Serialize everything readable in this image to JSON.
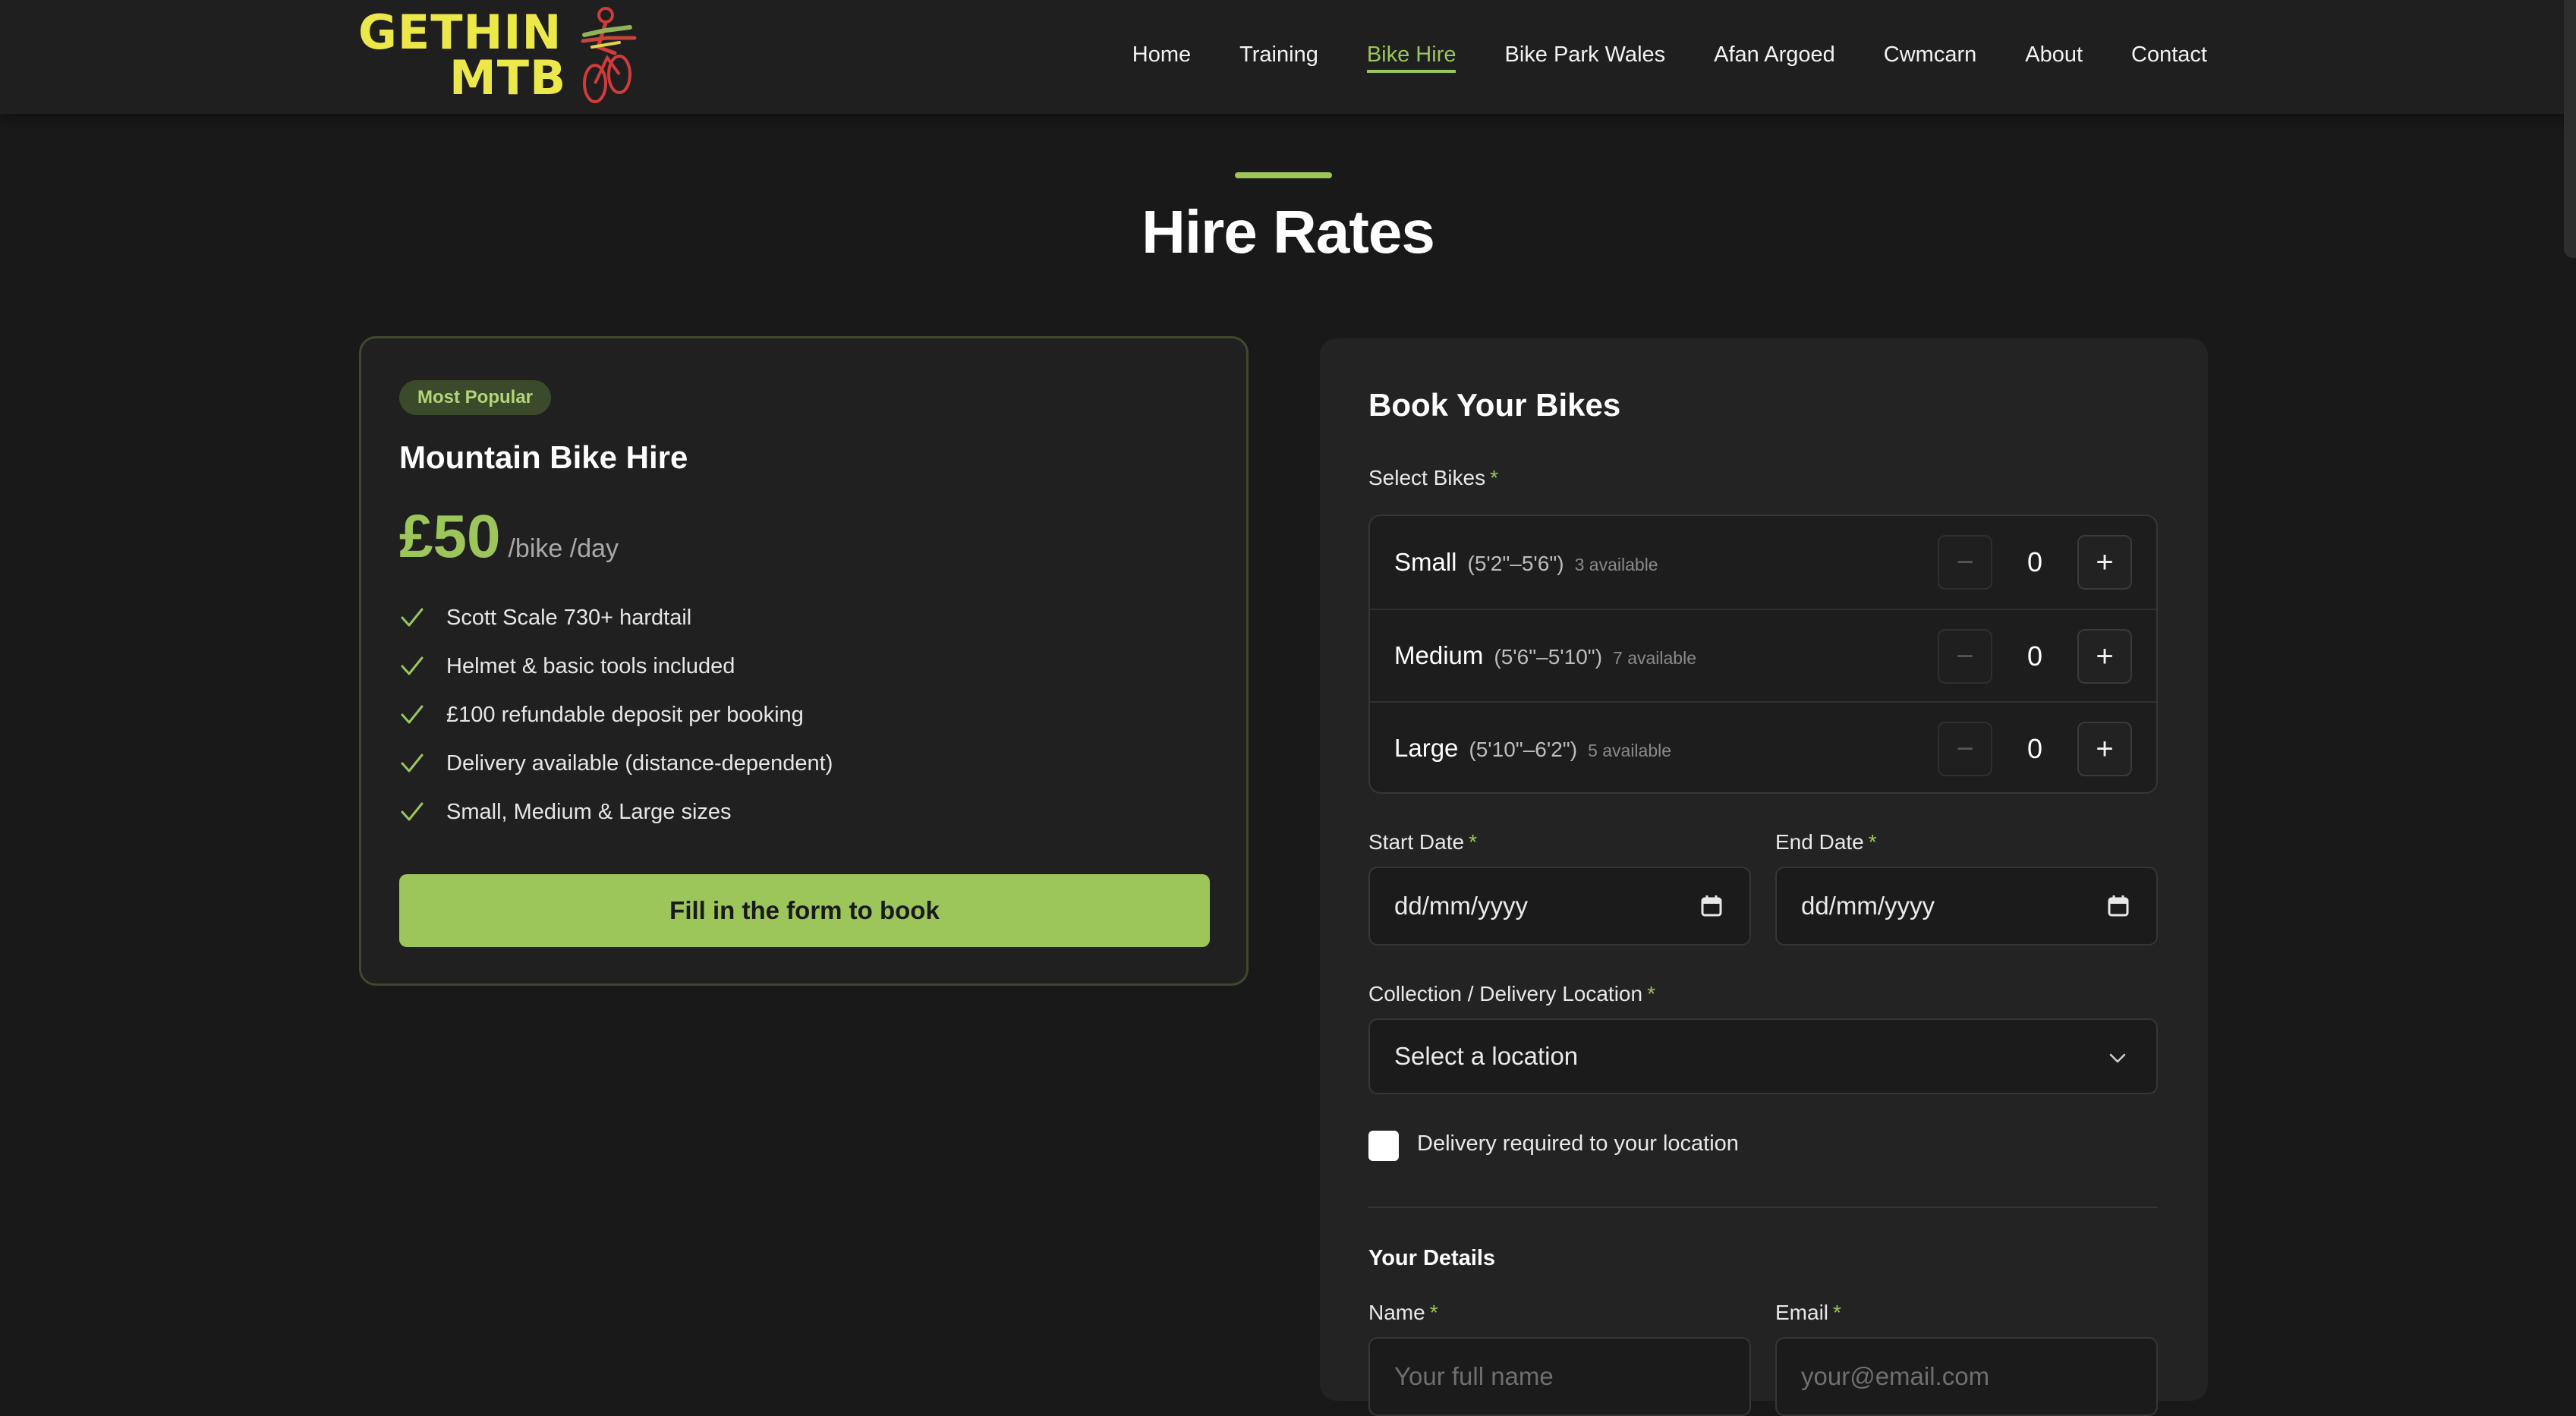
{
  "brand": {
    "line1": "GETHIN",
    "line2": "MTB"
  },
  "nav": [
    {
      "label": "Home",
      "active": false
    },
    {
      "label": "Training",
      "active": false
    },
    {
      "label": "Bike Hire",
      "active": true
    },
    {
      "label": "Bike Park Wales",
      "active": false
    },
    {
      "label": "Afan Argoed",
      "active": false
    },
    {
      "label": "Cwmcarn",
      "active": false
    },
    {
      "label": "About",
      "active": false
    },
    {
      "label": "Contact",
      "active": false
    }
  ],
  "section": {
    "title": "Hire Rates"
  },
  "pricing": {
    "badge": "Most Popular",
    "title": "Mountain Bike Hire",
    "price": "£50",
    "unit": "/bike /day",
    "features": [
      "Scott Scale 730+ hardtail",
      "Helmet & basic tools included",
      "£100 refundable deposit per booking",
      "Delivery available (distance-dependent)",
      "Small, Medium & Large sizes"
    ],
    "cta": "Fill in the form to book"
  },
  "form": {
    "title": "Book Your Bikes",
    "required_mark": "*",
    "select_bikes_label": "Select Bikes",
    "bikes": [
      {
        "name": "Small",
        "range": "(5'2\"–5'6\")",
        "available": "3 available",
        "qty": "0"
      },
      {
        "name": "Medium",
        "range": "(5'6\"–5'10\")",
        "available": "7 available",
        "qty": "0"
      },
      {
        "name": "Large",
        "range": "(5'10\"–6'2\")",
        "available": "5 available",
        "qty": "0"
      }
    ],
    "minus_symbol": "−",
    "plus_symbol": "+",
    "start_date_label": "Start Date",
    "start_date_value": "dd/mm/yyyy",
    "end_date_label": "End Date",
    "end_date_value": "dd/mm/yyyy",
    "location_label": "Collection / Delivery Location",
    "location_value": "Select a location",
    "delivery_checkbox_label": "Delivery required to your location",
    "delivery_checked": false,
    "details_heading": "Your Details",
    "name_label": "Name",
    "name_placeholder": "Your full name",
    "email_label": "Email",
    "email_placeholder": "your@email.com"
  },
  "colors": {
    "accent": "#9cc55a",
    "logo_yellow": "#ede84a",
    "background": "#191919",
    "card": "#202020"
  }
}
